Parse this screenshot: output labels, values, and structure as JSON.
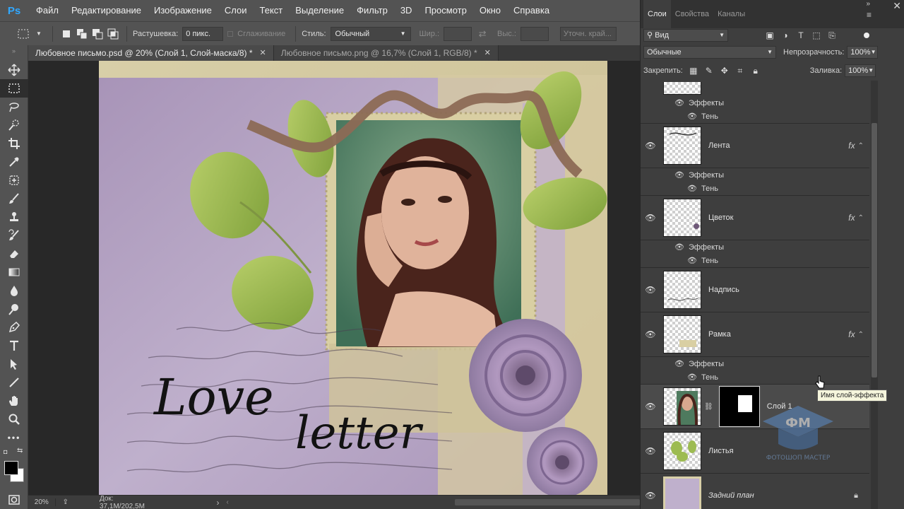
{
  "app": {
    "logo": "Ps",
    "accent": "#31a8ff"
  },
  "menu": [
    "Файл",
    "Редактирование",
    "Изображение",
    "Слои",
    "Текст",
    "Выделение",
    "Фильтр",
    "3D",
    "Просмотр",
    "Окно",
    "Справка"
  ],
  "options": {
    "feather_label": "Растушевка:",
    "feather_value": "0 пикс.",
    "antialias_label": "Сглаживание",
    "style_label": "Стиль:",
    "style_value": "Обычный",
    "width_label": "Шир.:",
    "height_label": "Выс.:",
    "refine_edge": "Уточн. край..."
  },
  "tabs": [
    {
      "title": "Любовное письмо.psd @ 20% (Слой 1, Слой-маска/8) *",
      "active": true
    },
    {
      "title": "Любовное письмо.png @ 16,7% (Слой 1, RGB/8) *",
      "active": false
    }
  ],
  "status": {
    "zoom": "20%",
    "doc": "Док: 37,1M/202,5M"
  },
  "canvas_text": {
    "title_1": "Love",
    "title_2": "letter"
  },
  "panel": {
    "tabs": [
      "Слои",
      "Свойства",
      "Каналы"
    ],
    "filter_kind": "Вид",
    "blend_mode": "Обычные",
    "opacity_label": "Непрозрачность:",
    "opacity_value": "100%",
    "lock_label": "Закрепить:",
    "fill_label": "Заливка:",
    "fill_value": "100%"
  },
  "layers": {
    "effects_label": "Эффекты",
    "shadow_label": "Тень",
    "lenta": "Лента",
    "tsvetok": "Цветок",
    "nadpis": "Надпись",
    "ramka": "Рамка",
    "sloy1": "Слой 1",
    "listya": "Листья",
    "background": "Задний план",
    "fx": "fx"
  },
  "tooltip": "Имя слой-эффекта",
  "watermark": {
    "line1": "ФМ",
    "line2": "ФОТОШОП МАСТЕР"
  }
}
